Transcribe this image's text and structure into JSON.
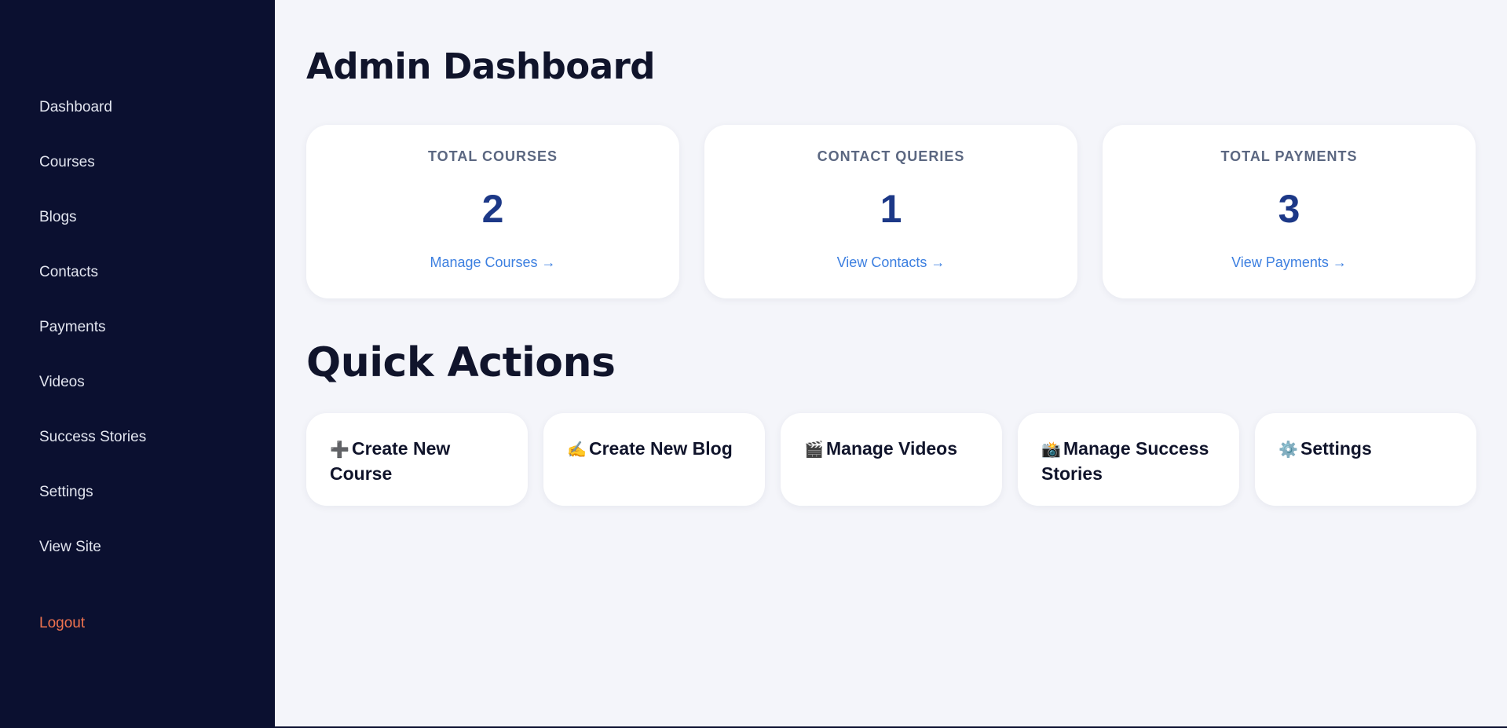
{
  "sidebar": {
    "items": [
      {
        "label": "Dashboard"
      },
      {
        "label": "Courses"
      },
      {
        "label": "Blogs"
      },
      {
        "label": "Contacts"
      },
      {
        "label": "Payments"
      },
      {
        "label": "Videos"
      },
      {
        "label": "Success Stories"
      },
      {
        "label": "Settings"
      },
      {
        "label": "View Site"
      }
    ],
    "logout_label": "Logout"
  },
  "main": {
    "title": "Admin Dashboard",
    "stats": [
      {
        "label": "TOTAL COURSES",
        "value": "2",
        "link": "Manage Courses →"
      },
      {
        "label": "CONTACT QUERIES",
        "value": "1",
        "link": "View Contacts →"
      },
      {
        "label": "TOTAL PAYMENTS",
        "value": "3",
        "link": "View Payments →"
      }
    ],
    "quick_actions_title": "Quick Actions",
    "actions": [
      {
        "icon": "➕",
        "icon_name": "plus-icon",
        "label": "Create New Course"
      },
      {
        "icon": "✍️",
        "icon_name": "writing-hand-icon",
        "label": "Create New Blog"
      },
      {
        "icon": "🎬",
        "icon_name": "clapper-board-icon",
        "label": "Manage Videos"
      },
      {
        "icon": "📸",
        "icon_name": "camera-icon",
        "label": "Manage Success Stories"
      },
      {
        "icon": "⚙️",
        "icon_name": "gear-icon",
        "label": "Settings"
      }
    ]
  },
  "colors": {
    "sidebar_bg": "#0b1030",
    "page_bg": "#f4f5fa",
    "stat_value": "#1c3887",
    "link": "#3c7fe0",
    "logout": "#f0734f"
  }
}
